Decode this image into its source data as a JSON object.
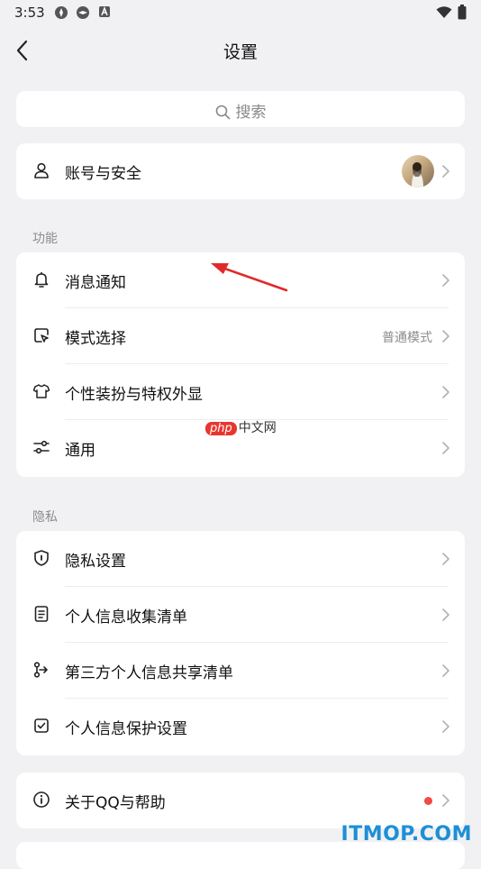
{
  "status_bar": {
    "time": "3:53"
  },
  "header": {
    "title": "设置",
    "back_icon": "chevron-left-icon"
  },
  "search": {
    "placeholder": "搜索",
    "icon": "search-icon"
  },
  "account": {
    "label": "账号与安全",
    "icon": "user-icon"
  },
  "sections": [
    {
      "title": "功能",
      "items": [
        {
          "label": "消息通知",
          "value": "",
          "icon": "bell-icon"
        },
        {
          "label": "模式选择",
          "value": "普通模式",
          "icon": "mode-icon"
        },
        {
          "label": "个性装扮与特权外显",
          "value": "",
          "icon": "shirt-icon"
        },
        {
          "label": "通用",
          "value": "",
          "icon": "sliders-icon"
        }
      ]
    },
    {
      "title": "隐私",
      "items": [
        {
          "label": "隐私设置",
          "icon": "shield-icon"
        },
        {
          "label": "个人信息收集清单",
          "icon": "document-icon"
        },
        {
          "label": "第三方个人信息共享清单",
          "icon": "share-flow-icon"
        },
        {
          "label": "个人信息保护设置",
          "icon": "checkbox-icon"
        }
      ]
    }
  ],
  "about": {
    "label": "关于QQ与帮助",
    "icon": "info-icon",
    "badge_color": "#f04b44"
  },
  "watermark": {
    "php": "php",
    "cn": "中文网"
  },
  "branding": {
    "text": "ITMOP.COM"
  },
  "colors": {
    "background": "#f1f1f4",
    "card": "#ffffff",
    "annotation_arrow": "#e02a2a",
    "brand": "#1d8fd6"
  }
}
